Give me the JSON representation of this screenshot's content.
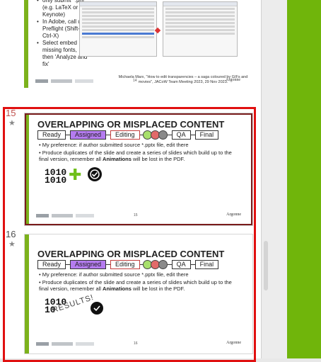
{
  "top_slide": {
    "bullets": [
      "only submit *.pdf (e.g. LaTeX or Keynote)",
      "In Adobe, call up Preflight (Shift-Ctrl-X)",
      "Select embed missing fonts, then 'Analyze and fix'"
    ],
    "caption": "Michaela Marx, \"How to edit transparencies – a saga coloured by GIFs and movies\", JACoW Team Meeting 2023, 29 Nov 2023.",
    "page": "14",
    "argonne": "Argonne"
  },
  "slide15": {
    "number": "15",
    "star": "★",
    "title": "OVERLAPPING OR MISPLACED CONTENT",
    "flow": {
      "ready": "Ready",
      "assigned": "Assigned",
      "editing": "Editing",
      "qa": "QA",
      "final": "Final"
    },
    "circle_colors": [
      "#a8e06c",
      "#e26a6a",
      "#8a8a8a"
    ],
    "bullet1": "My preference: if author submitted source *.pptx file, edit there",
    "bullet2_pre": "Produce duplicates of the slide and create a series of slides which build up to the final version, remember all ",
    "bullet2_bold": "Animations",
    "bullet2_post": " will be lost in the PDF.",
    "binary_icon": "1010\n1010",
    "plus_icon": "✚",
    "page": "15",
    "argonne": "Argonne"
  },
  "slide16": {
    "number": "16",
    "star": "★",
    "title": "OVERLAPPING OR MISPLACED CONTENT",
    "flow": {
      "ready": "Ready",
      "assigned": "Assigned",
      "editing": "Editing",
      "qa": "QA",
      "final": "Final"
    },
    "bullet1": "My preference: if author submitted source *.pptx file, edit there",
    "bullet2_pre": "Produce duplicates of the slide and create a series of slides which build up to the final version, remember all ",
    "bullet2_bold": "Animations",
    "bullet2_post": " will be lost in the PDF.",
    "binary_icon": "1010\n10",
    "results": "RESULTS!",
    "page": "16",
    "argonne": "Argonne"
  }
}
